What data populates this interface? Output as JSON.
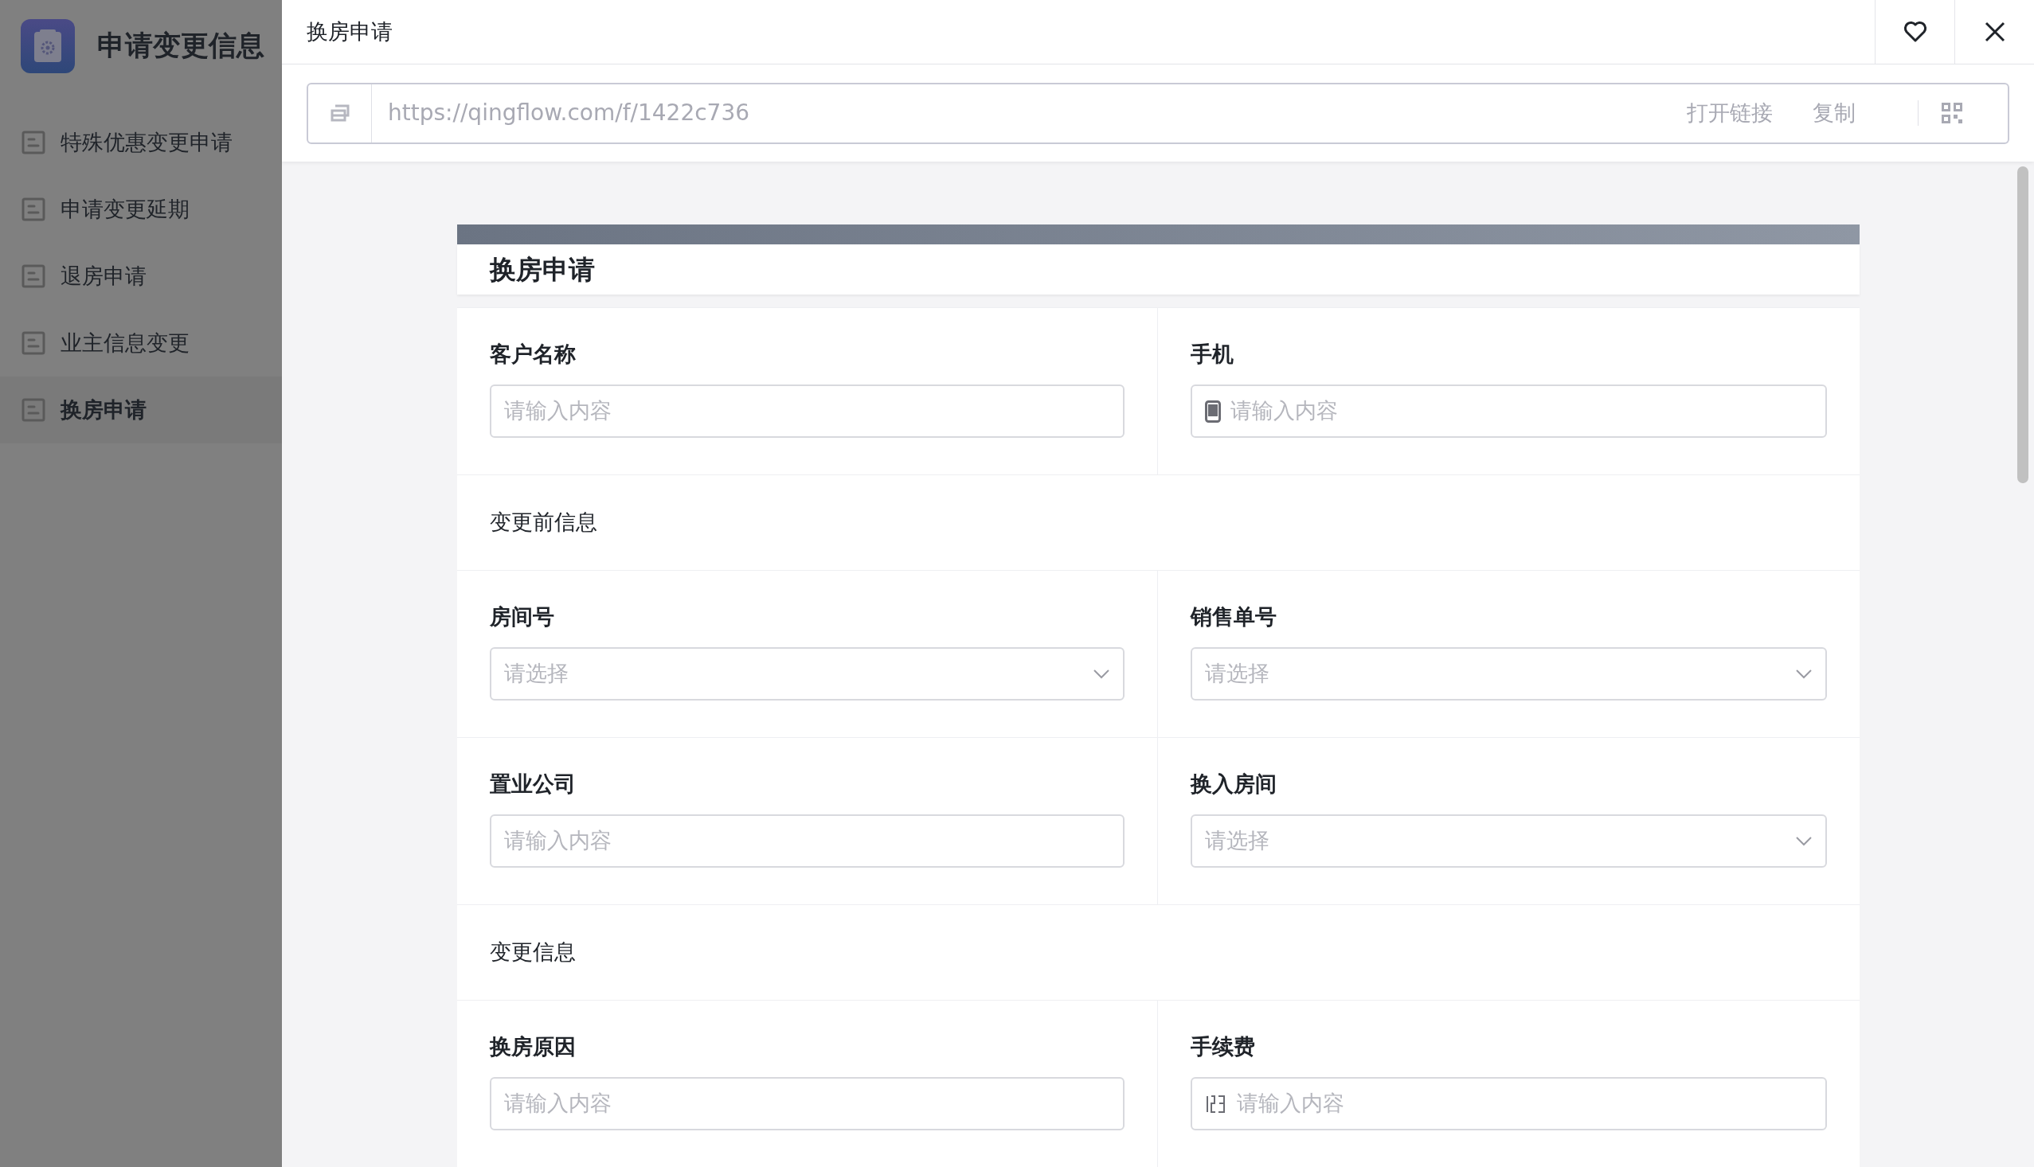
{
  "app": {
    "title": "申请变更信息"
  },
  "sidebar": {
    "items": [
      {
        "label": "特殊优惠变更申请",
        "selected": false
      },
      {
        "label": "申请变更延期",
        "selected": false
      },
      {
        "label": "退房申请",
        "selected": false
      },
      {
        "label": "业主信息变更",
        "selected": false
      },
      {
        "label": "换房申请",
        "selected": true
      }
    ]
  },
  "panel": {
    "title": "换房申请"
  },
  "link_bar": {
    "url": "https://qingflow.com/f/1422c736",
    "actions": [
      "打开链接",
      "复制"
    ]
  },
  "form": {
    "title": "换房申请",
    "rows": [
      {
        "kind": "fields",
        "fields": [
          {
            "label": "客户名称",
            "kind": "text",
            "placeholder": "请输入内容"
          },
          {
            "label": "手机",
            "kind": "phone",
            "placeholder": "请输入内容"
          }
        ]
      },
      {
        "kind": "section",
        "label": "变更前信息"
      },
      {
        "kind": "fields",
        "fields": [
          {
            "label": "房间号",
            "kind": "select",
            "placeholder": "请选择"
          },
          {
            "label": "销售单号",
            "kind": "select",
            "placeholder": "请选择"
          }
        ]
      },
      {
        "kind": "fields",
        "fields": [
          {
            "label": "置业公司",
            "kind": "text",
            "placeholder": "请输入内容"
          },
          {
            "label": "换入房间",
            "kind": "select",
            "placeholder": "请选择"
          }
        ]
      },
      {
        "kind": "section",
        "label": "变更信息"
      },
      {
        "kind": "fields",
        "fields": [
          {
            "label": "换房原因",
            "kind": "text",
            "placeholder": "请输入内容"
          },
          {
            "label": "手续费",
            "kind": "number",
            "placeholder": "请输入内容"
          }
        ]
      }
    ]
  }
}
